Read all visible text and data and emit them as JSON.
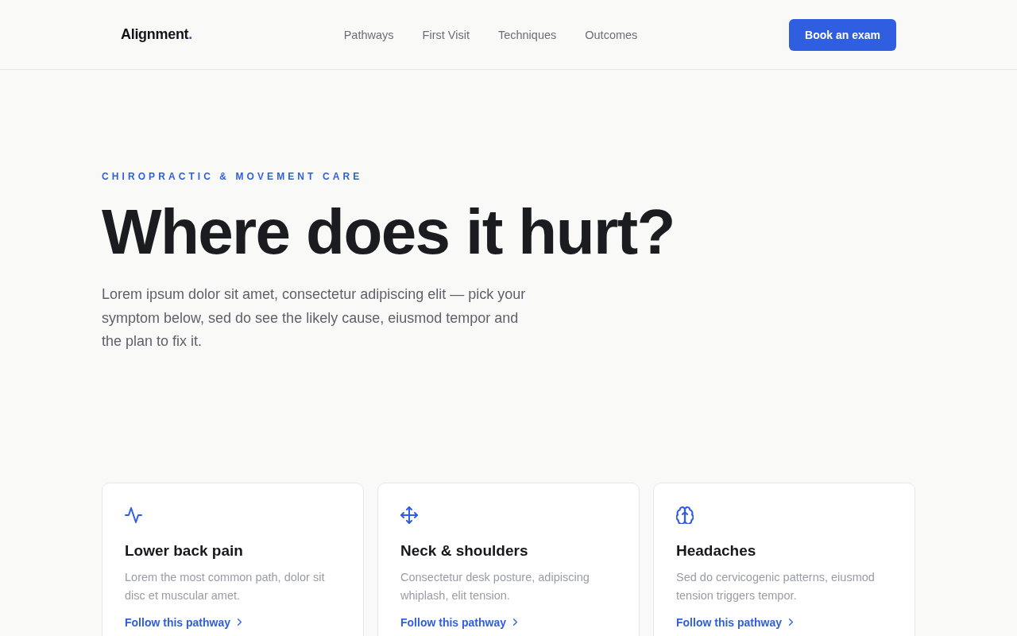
{
  "header": {
    "logo": "Alignment",
    "logo_mark": ".",
    "nav": [
      {
        "label": "Pathways"
      },
      {
        "label": "First Visit"
      },
      {
        "label": "Techniques"
      },
      {
        "label": "Outcomes"
      }
    ],
    "cta": "Book an exam"
  },
  "hero": {
    "eyebrow": "CHIROPRACTIC & MOVEMENT CARE",
    "title": "Where does it hurt?",
    "intro": "Lorem ipsum dolor sit amet, consectetur adipiscing elit — pick your symptom below, sed do see the likely cause, eiusmod tempor and the plan to fix it."
  },
  "pathways": [
    {
      "title": "Lower back pain",
      "description": "Lorem the most common path, dolor sit disc et muscular amet.",
      "link": "Follow this pathway"
    },
    {
      "title": "Neck & shoulders",
      "description": "Consectetur desk posture, adipiscing whiplash, elit tension.",
      "link": "Follow this pathway"
    },
    {
      "title": "Headaches",
      "description": "Sed do cervicogenic patterns, eiusmod tension triggers tempor.",
      "link": "Follow this pathway"
    }
  ]
}
